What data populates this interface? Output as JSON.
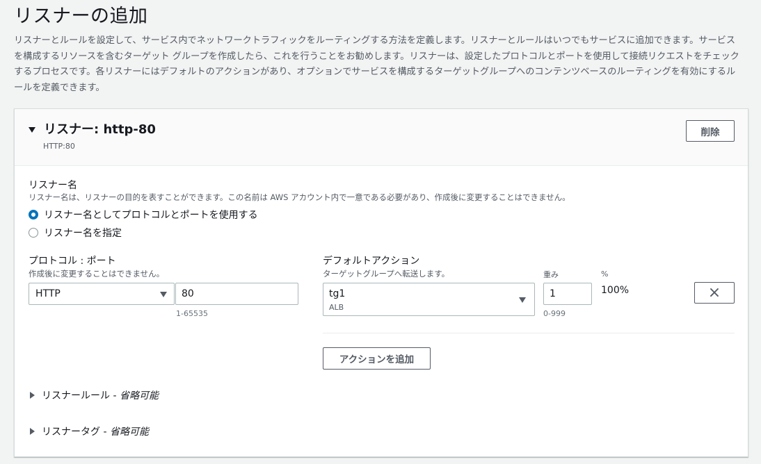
{
  "page": {
    "title": "リスナーの追加",
    "description": "リスナーとルールを設定して、サービス内でネットワークトラフィックをルーティングする方法を定義します。リスナーとルールはいつでもサービスに追加できます。サービスを構成するリソースを含むターゲット グループを作成したら、これを行うことをお勧めします。リスナーは、設定したプロトコルとポートを使用して接続リクエストをチェックするプロセスです。各リスナーにはデフォルトのアクションがあり、オプションでサービスを構成するターゲットグループへのコンテンツベースのルーティングを有効にするルールを定義できます。"
  },
  "listener": {
    "title": "リスナー: http-80",
    "subtitle": "HTTP:80",
    "delete_label": "削除",
    "name_section": {
      "label": "リスナー名",
      "hint": "リスナー名は、リスナーの目的を表すことができます。この名前は AWS アカウント内で一意である必要があり、作成後に変更することはできません。",
      "options": [
        {
          "label": "リスナー名としてプロトコルとポートを使用する",
          "selected": true
        },
        {
          "label": "リスナー名を指定",
          "selected": false
        }
      ]
    },
    "protocol_port": {
      "label": "プロトコル : ポート",
      "hint": "作成後に変更することはできません。",
      "protocol": "HTTP",
      "port": "80",
      "port_range": "1-65535"
    },
    "default_action": {
      "label": "デフォルトアクション",
      "hint": "ターゲットグループへ転送します。",
      "target_group": "tg1",
      "target_group_type": "ALB",
      "weight_label": "重み",
      "weight": "1",
      "weight_range": "0-999",
      "percent_label": "%",
      "percent": "100%",
      "remove_label": "×"
    },
    "add_action_label": "アクションを追加",
    "rules_label": "リスナールール - ",
    "rules_optional": "省略可能",
    "tags_label": "リスナータグ - ",
    "tags_optional": "省略可能"
  },
  "colors": {
    "primary": "#0073bb",
    "text": "#16191f",
    "muted": "#545b64",
    "background": "#f2f3f3"
  }
}
